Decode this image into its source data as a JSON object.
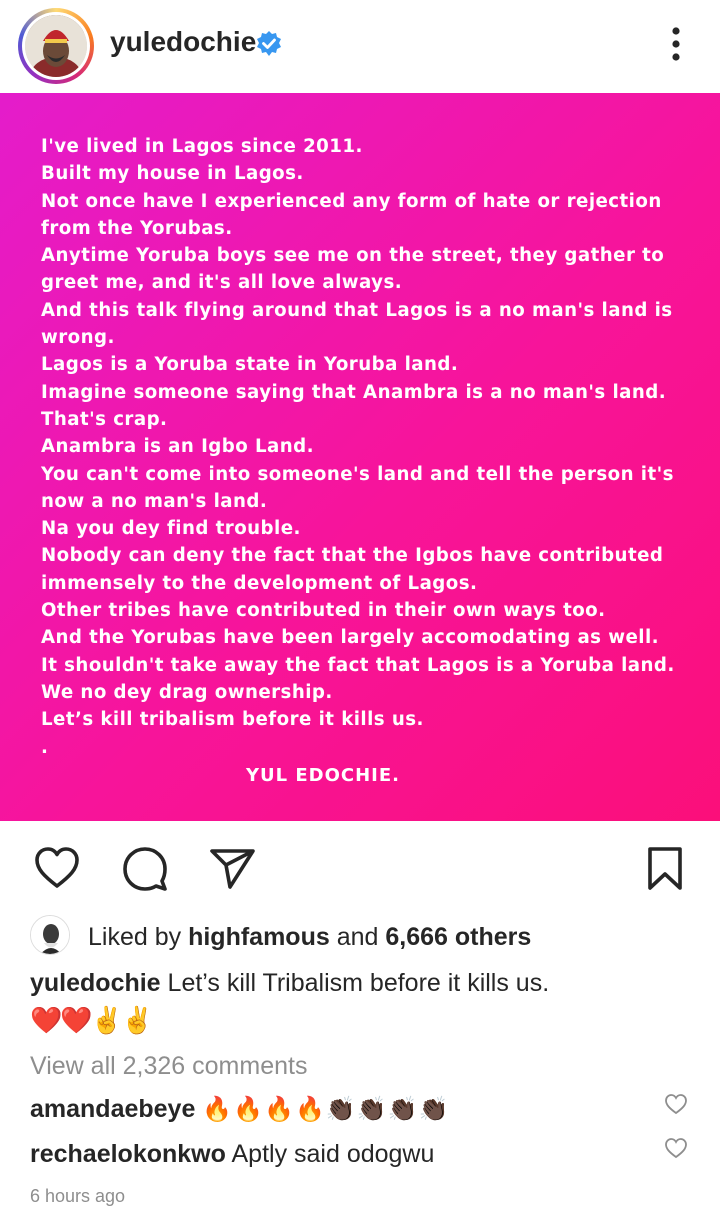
{
  "header": {
    "username": "yuledochie",
    "verified": true,
    "avatar_icon": "profile-avatar",
    "more_icon": "more-vertical-icon"
  },
  "post": {
    "background_colors": [
      "#e41ccb",
      "#fb0f7a"
    ],
    "lines": [
      "I've lived in Lagos since 2011.",
      "Built my house in Lagos.",
      "Not once have I experienced any form of hate or rejection",
      "from the Yorubas.",
      "Anytime Yoruba boys see me on the street, they gather to",
      "greet me, and it's all love always.",
      "And this talk flying around that Lagos is a no man's land is",
      "wrong.",
      "Lagos is a Yoruba state in Yoruba land.",
      "Imagine someone saying that Anambra is a no man's land.",
      "That's crap.",
      "Anambra is an Igbo Land.",
      "You can't come into someone's land and tell the person it's",
      "now a no man's land.",
      "Na you dey find trouble.",
      "Nobody can deny the fact that the Igbos have contributed",
      "immensely to the development of Lagos.",
      "Other tribes have contributed in their own ways too.",
      "And the Yorubas have been largely accomodating as well.",
      "It shouldn't take away the fact that Lagos is a Yoruba land.",
      "We no dey drag ownership.",
      "Let’s kill tribalism before it kills us.",
      "."
    ],
    "signature": "YUL EDOCHIE."
  },
  "actions": {
    "like_icon": "heart-icon",
    "comment_icon": "comment-icon",
    "share_icon": "send-icon",
    "save_icon": "bookmark-icon"
  },
  "likes": {
    "prefix": "Liked by",
    "user": "highfamous",
    "middle": "and",
    "others": "6,666 others"
  },
  "caption": {
    "username": "yuledochie",
    "text": "Let’s kill Tribalism before it kills us.",
    "emoji": "❤️❤️✌️✌️"
  },
  "view_comments": "View all 2,326 comments",
  "comments": [
    {
      "username": "amandaebeye",
      "text": "🔥🔥🔥🔥👏🏿👏🏿👏🏿👏🏿"
    },
    {
      "username": "rechaelokonkwo",
      "text": "Aptly said odogwu"
    }
  ],
  "timestamp": "6 hours ago"
}
